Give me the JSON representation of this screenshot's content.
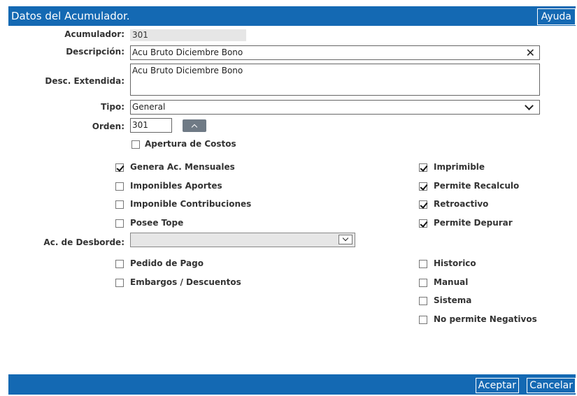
{
  "window": {
    "title": "Datos del Acumulador.",
    "help_label": "Ayuda"
  },
  "form": {
    "acumulador": {
      "label": "Acumulador:",
      "value": "301"
    },
    "descripcion": {
      "label": "Descripción:",
      "value": "Acu Bruto Diciembre Bono"
    },
    "desc_extendida": {
      "label": "Desc. Extendida:",
      "value": "Acu Bruto Diciembre Bono"
    },
    "tipo": {
      "label": "Tipo:",
      "value": "General"
    },
    "orden": {
      "label": "Orden:",
      "value": "301"
    },
    "desborde": {
      "label": "Ac. de Desborde:",
      "value": ""
    }
  },
  "checkboxes": {
    "apertura_costos": {
      "label": "Apertura de Costos",
      "checked": false
    },
    "genera_ac_mensuales": {
      "label": "Genera Ac. Mensuales",
      "checked": true
    },
    "imponibles_aportes": {
      "label": "Imponibles Aportes",
      "checked": false
    },
    "imponible_contribuciones": {
      "label": "Imponible Contribuciones",
      "checked": false
    },
    "posee_tope": {
      "label": "Posee Tope",
      "checked": false
    },
    "imprimible": {
      "label": "Imprimible",
      "checked": true
    },
    "permite_recalculo": {
      "label": "Permite Recalculo",
      "checked": true
    },
    "retroactivo": {
      "label": "Retroactivo",
      "checked": true
    },
    "permite_depurar": {
      "label": "Permite Depurar",
      "checked": true
    },
    "pedido_de_pago": {
      "label": "Pedido de Pago",
      "checked": false
    },
    "embargos_descuentos": {
      "label": "Embargos / Descuentos",
      "checked": false
    },
    "historico": {
      "label": "Historico",
      "checked": false
    },
    "manual": {
      "label": "Manual",
      "checked": false
    },
    "sistema": {
      "label": "Sistema",
      "checked": false
    },
    "no_permite_negativos": {
      "label": "No permite Negativos",
      "checked": false
    }
  },
  "footer": {
    "accept_label": "Aceptar",
    "cancel_label": "Cancelar"
  },
  "colors": {
    "accent": "#1469b3",
    "readonly_bg": "#e6e6e6"
  },
  "icons": {
    "clear": "close-icon",
    "tipo_dropdown": "chevron-down-icon",
    "orden_stepper": "chevron-up-icon",
    "desborde_dropdown": "chevron-down-icon"
  }
}
